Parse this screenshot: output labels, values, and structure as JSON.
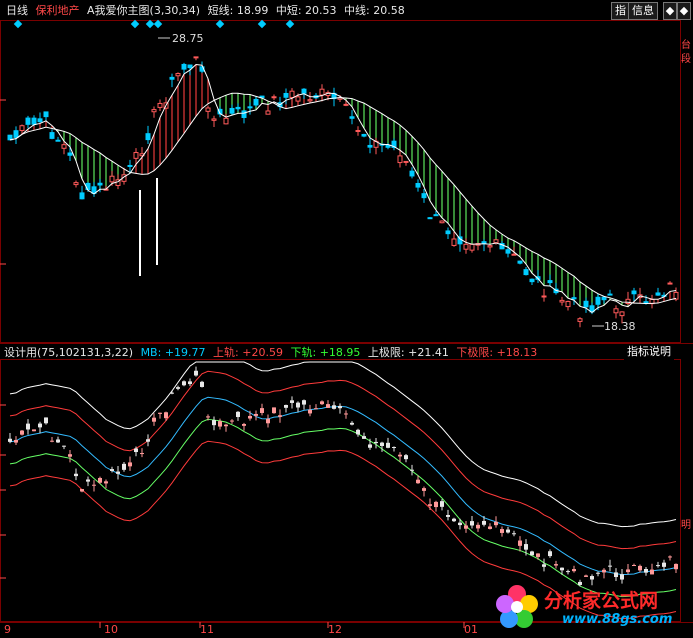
{
  "top_header": {
    "period": "日线",
    "stock": "保利地产",
    "formula": "A我爱你主图",
    "params": "(3,30,34)",
    "short_label": "短线:",
    "short_value": "18.99",
    "midshort_label": "中短:",
    "midshort_value": "20.53",
    "mid_label": "中线:",
    "mid_value": "20.58"
  },
  "toolbar": {
    "zhi": "指",
    "info": "信息",
    "left_arrow": "◆",
    "right_arrow": "◆"
  },
  "price_annotations": {
    "high": "28.75",
    "low": "18.38"
  },
  "sub_header": {
    "formula": "设计用",
    "params": "(75,102131,3,22)",
    "mb_label": "MB:",
    "mb_value": "+19.77",
    "upper_label": "上轨:",
    "upper_value": "+20.59",
    "lower_label": "下轨:",
    "lower_value": "+18.95",
    "upper_limit_label": "上极限:",
    "upper_limit_value": "+21.41",
    "lower_limit_label": "下极限:",
    "lower_limit_value": "+18.13",
    "help": "指标说明"
  },
  "x_axis": [
    "9",
    "10",
    "11",
    "12",
    "01"
  ],
  "right_panel_labels": [
    "台",
    "段",
    "明"
  ],
  "watermark": {
    "name": "分析家公式网",
    "url": "www.88gs.com"
  },
  "colors": {
    "up": "#ff5a5a",
    "down": "#00ccff",
    "short": "#ffffff",
    "mid": "#ffff00",
    "band_up": "#ff3b3b",
    "band_down": "#66ff66",
    "upper_limit": "#ffffff",
    "mb": "#33bbff"
  }
}
